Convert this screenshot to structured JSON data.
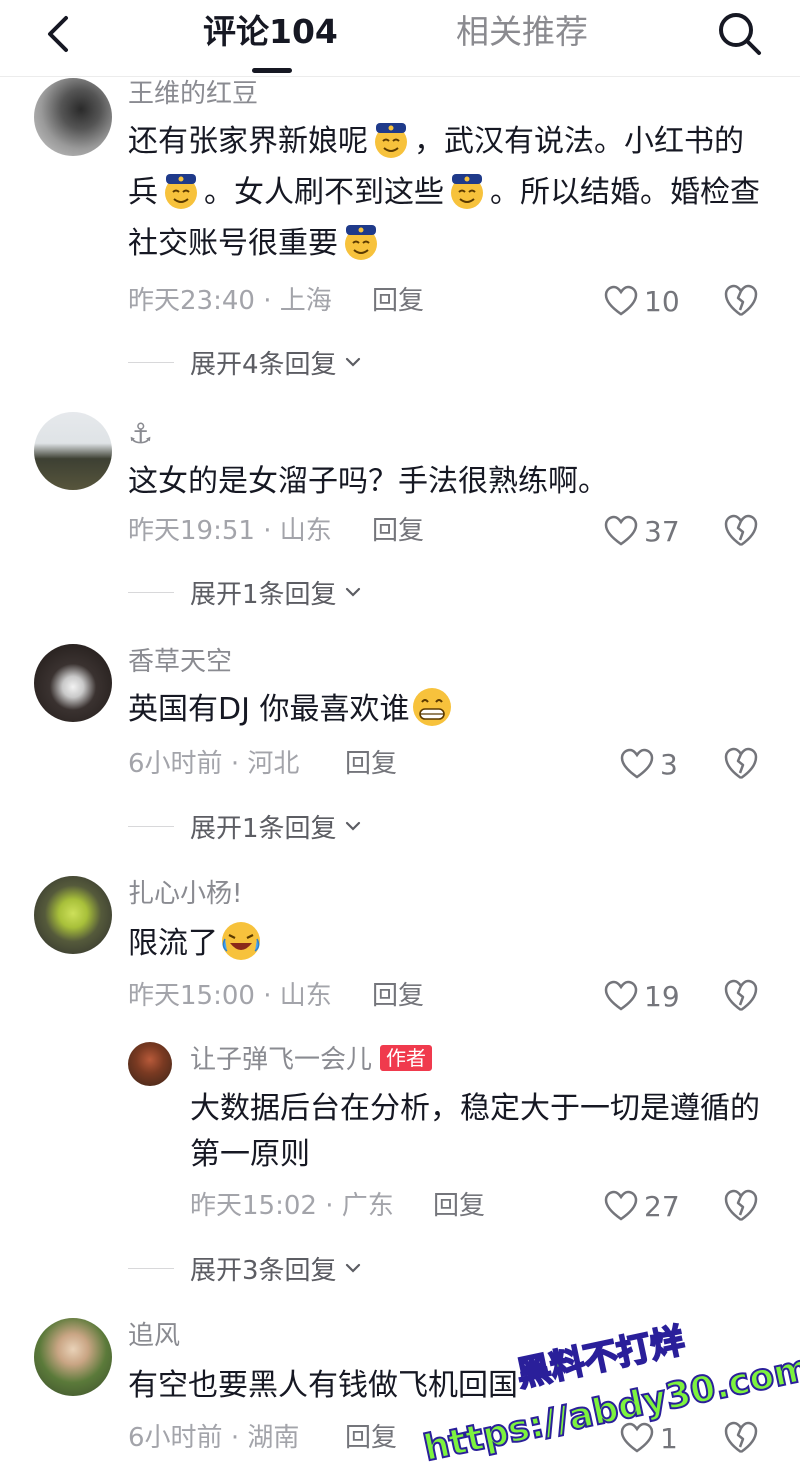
{
  "header": {
    "back_icon": "chevron-left-icon",
    "tab_comments": "评论104",
    "tab_recommend": "相关推荐",
    "search_icon": "search-icon"
  },
  "comments": [
    {
      "username": "王维的红豆",
      "text_parts": [
        "还有张家界新娘呢",
        "，武汉有说法。小红书的兵",
        "。女人刷不到这些",
        "。所以结婚。婚检查社交账号很重要"
      ],
      "emoji": "police-face-emoji",
      "time": "昨天23:40",
      "sep": "·",
      "location": "上海",
      "reply": "回复",
      "likes": "10",
      "expand": "展开4条回复"
    },
    {
      "username": "⚓",
      "text": "这女的是女溜子吗？手法很熟练啊。",
      "time": "昨天19:51",
      "sep": "·",
      "location": "山东",
      "reply": "回复",
      "likes": "37",
      "expand": "展开1条回复"
    },
    {
      "username": "香草天空",
      "text": "英国有DJ 你最喜欢谁",
      "emoji": "grin-face-emoji",
      "time": "6小时前",
      "sep": "·",
      "location": "河北",
      "reply": "回复",
      "likes": "3",
      "expand": "展开1条回复"
    },
    {
      "username": "扎心小杨!",
      "text": "限流了",
      "emoji": "laugh-cry-emoji",
      "time": "昨天15:00",
      "sep": "·",
      "location": "山东",
      "reply": "回复",
      "likes": "19",
      "sub_reply": {
        "username": "让子弹飞一会儿",
        "badge": "作者",
        "text": "大数据后台在分析，稳定大于一切是遵循的第一原则",
        "time": "昨天15:02",
        "sep": "·",
        "location": "广东",
        "reply": "回复",
        "likes": "27"
      },
      "expand": "展开3条回复"
    },
    {
      "username": "追风",
      "text": "有空也要黑人有钱做飞机回国",
      "time": "6小时前",
      "sep": "·",
      "location": "湖南",
      "reply": "回复",
      "likes": "1"
    }
  ],
  "watermark": {
    "line1": "黑料不打烊",
    "line2": "https://abdy30.com"
  },
  "colors": {
    "text_primary": "#161823",
    "text_secondary": "#8a8b91",
    "badge_red": "#f03a4d",
    "watermark_green": "#7df23e"
  }
}
